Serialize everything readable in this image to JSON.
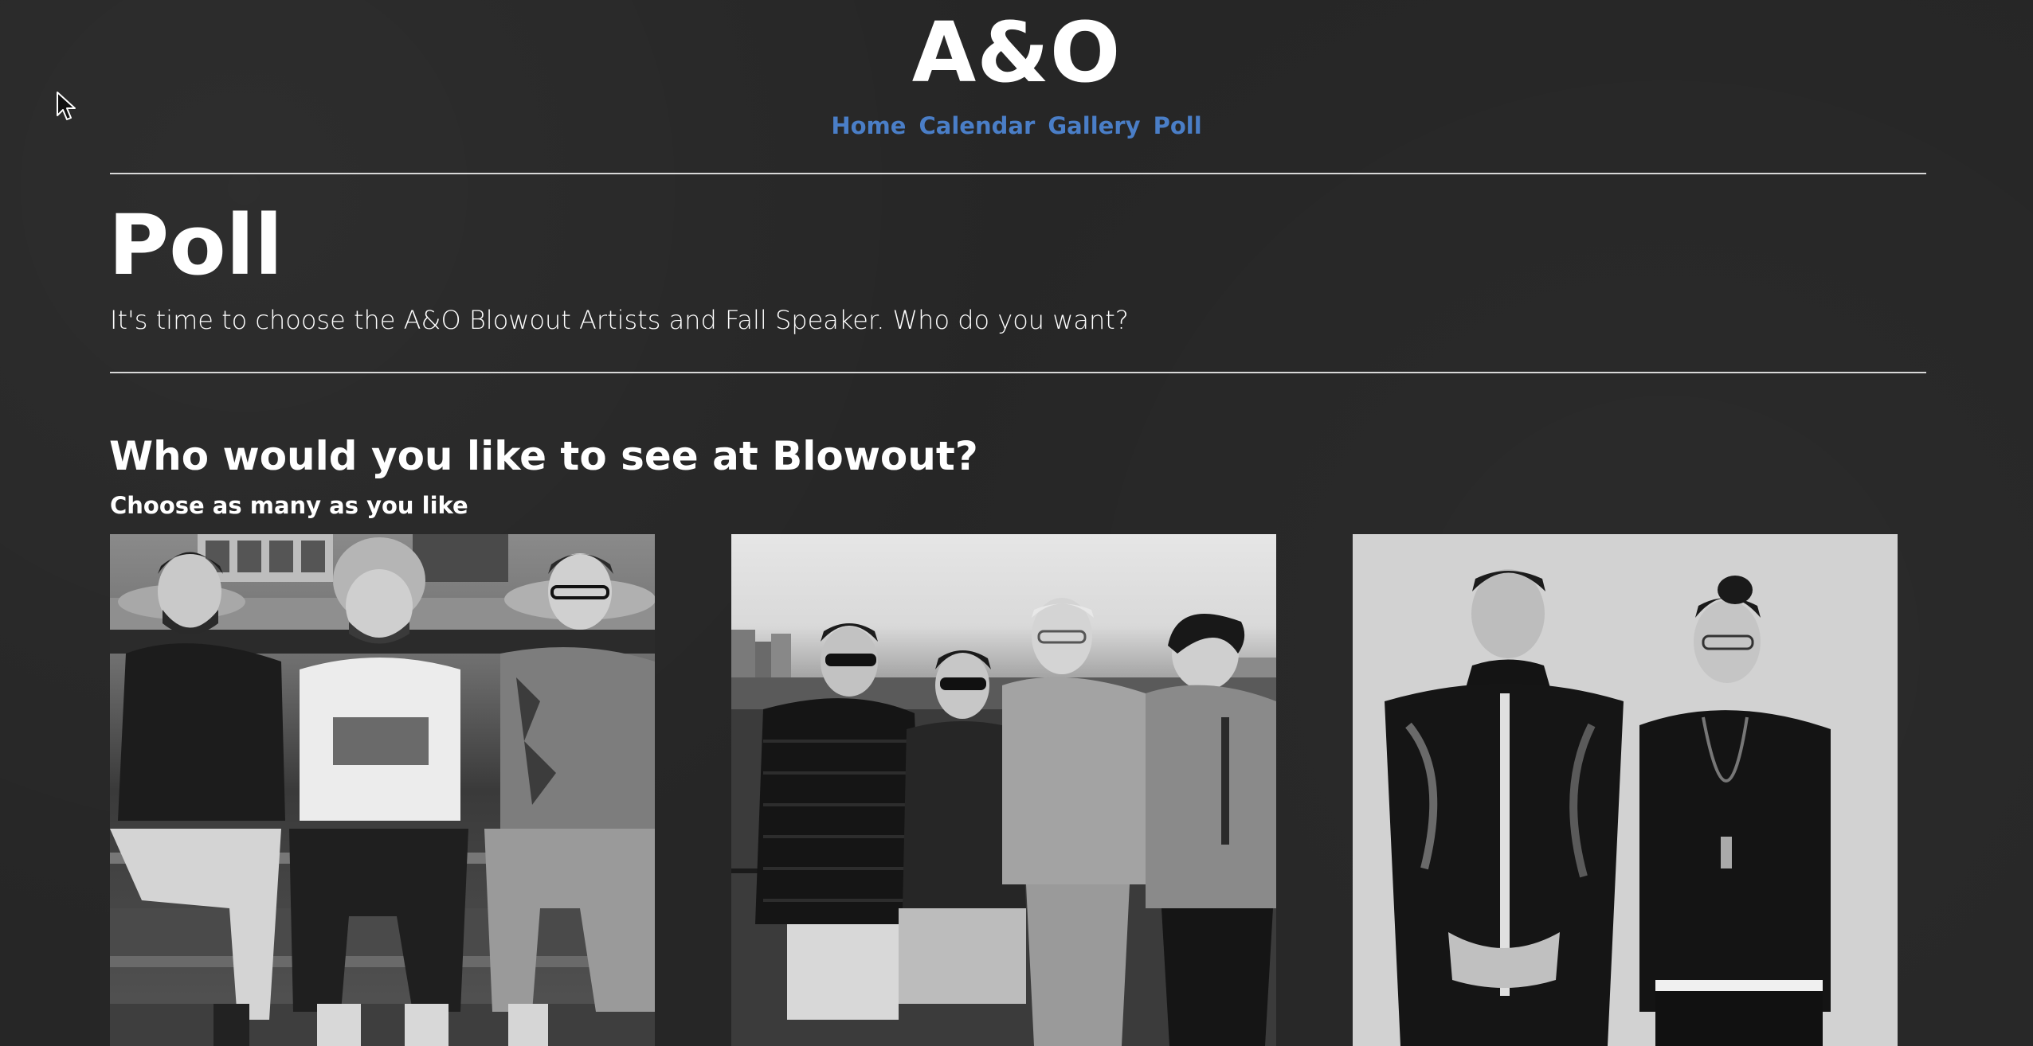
{
  "site": {
    "title": "A&O"
  },
  "nav": {
    "items": [
      "Home",
      "Calendar",
      "Gallery",
      "Poll"
    ]
  },
  "page": {
    "title": "Poll",
    "intro": "It's time to choose the A&O Blowout Artists and Fall Speaker. Who do you want?"
  },
  "section": {
    "title": "Who would you like to see at Blowout?",
    "subtitle": "Choose as many as you like"
  },
  "colors": {
    "background": "#262626",
    "link": "#4a7ec7",
    "text": "#ffffff"
  },
  "icons": {
    "cursor": "mouse-pointer-icon"
  }
}
